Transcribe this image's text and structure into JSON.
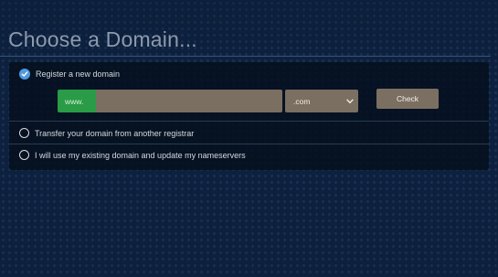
{
  "page": {
    "heading": "Choose a Domain..."
  },
  "options": {
    "register": {
      "label": "Register a new domain",
      "selected": true
    },
    "transfer": {
      "label": "Transfer your domain from another registrar",
      "selected": false
    },
    "existing": {
      "label": "I will use my existing domain and update my nameservers",
      "selected": false
    }
  },
  "register_form": {
    "prefix": "www.",
    "domain_value": "",
    "tld_selected": ".com",
    "check_label": "Check"
  },
  "colors": {
    "background": "#0d2240",
    "panel": "#06101e",
    "prefix_green": "#2a9b46",
    "input_brown": "#7b6f62",
    "radio_checked": "#4f9ae0"
  },
  "icons": {
    "checked_radio": "checkmark-circle-icon",
    "select_arrow": "chevron-down-icon"
  }
}
